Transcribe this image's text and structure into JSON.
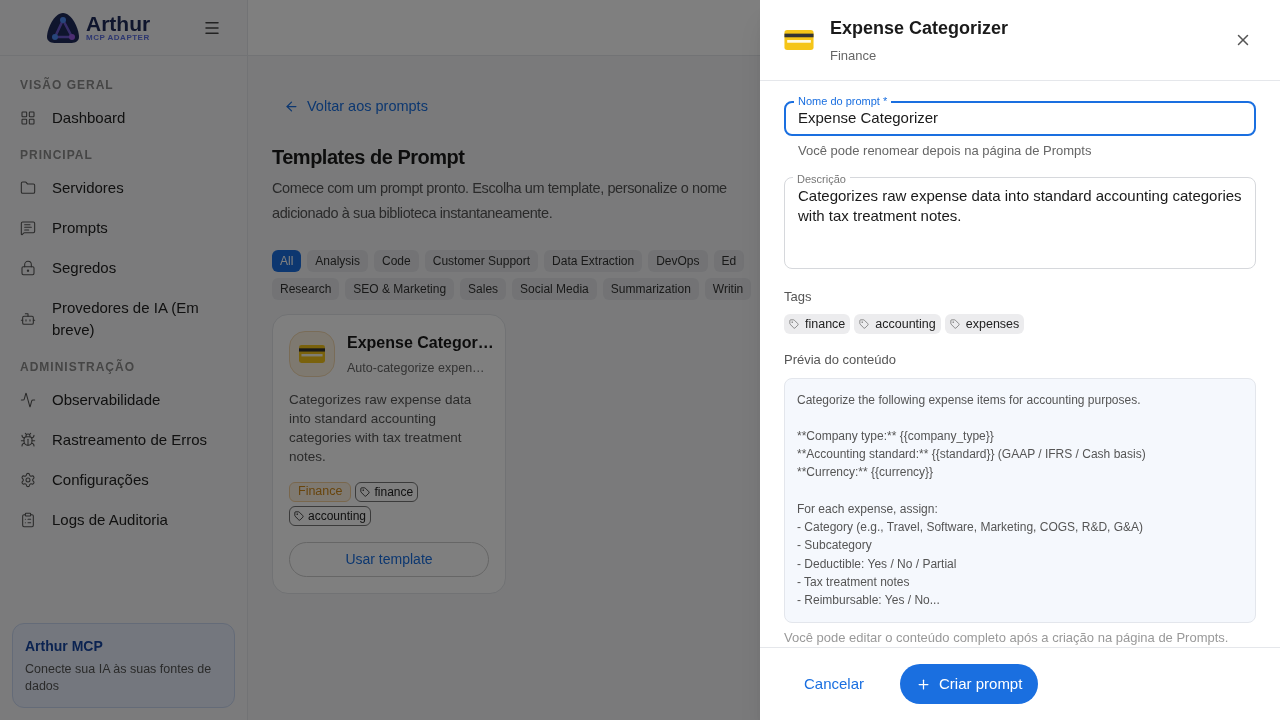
{
  "sidebar": {
    "logo": {
      "name": "Arthur",
      "tagline": "MCP ADAPTER"
    },
    "sections": [
      {
        "title": "VISÃO GERAL",
        "items": [
          {
            "label": "Dashboard"
          }
        ]
      },
      {
        "title": "PRINCIPAL",
        "items": [
          {
            "label": "Servidores"
          },
          {
            "label": "Prompts"
          },
          {
            "label": "Segredos"
          },
          {
            "label": "Provedores de IA (Em breve)"
          }
        ]
      },
      {
        "title": "ADMINISTRAÇÃO",
        "items": [
          {
            "label": "Observabilidade"
          },
          {
            "label": "Rastreamento de Erros"
          },
          {
            "label": "Configurações"
          },
          {
            "label": "Logs de Auditoria"
          }
        ]
      }
    ],
    "promo": {
      "title": "Arthur MCP",
      "text": "Conecte sua IA às suas fontes de dados"
    }
  },
  "main": {
    "back_link": "Voltar aos prompts",
    "title": "Templates de Prompt",
    "description_lines": [
      "Comece com um prompt pronto. Escolha um template, personalize o nome",
      "adicionado à sua biblioteca instantaneamente."
    ],
    "chip_rows": [
      [
        {
          "label": "All",
          "selected": true
        },
        {
          "label": "Analysis",
          "selected": false
        },
        {
          "label": "Code",
          "selected": false
        },
        {
          "label": "Customer Support",
          "selected": false
        },
        {
          "label": "Data Extraction",
          "selected": false
        },
        {
          "label": "DevOps",
          "selected": false
        },
        {
          "label": "Ed",
          "selected": false
        }
      ],
      [
        {
          "label": "Research",
          "selected": false
        },
        {
          "label": "SEO & Marketing",
          "selected": false
        },
        {
          "label": "Sales",
          "selected": false
        },
        {
          "label": "Social Media",
          "selected": false
        },
        {
          "label": "Summarization",
          "selected": false
        },
        {
          "label": "Writin",
          "selected": false
        }
      ]
    ],
    "cards": [
      {
        "title": "Expense Categor…",
        "subtitle": "Auto-categorize expen…",
        "description": "Categorizes raw expense data into standard accounting categories with tax treatment notes.",
        "category": "Finance",
        "tags": [
          "finance",
          "accounting"
        ],
        "button": "Usar template"
      }
    ]
  },
  "drawer": {
    "title": "Expense Categorizer",
    "category": "Finance",
    "name_field": {
      "label": "Nome do prompt *",
      "value": "Expense Categorizer",
      "helper": "Você pode renomear depois na página de Prompts"
    },
    "description_field": {
      "label": "Descrição",
      "value": "Categorizes raw expense data into standard accounting categories with tax treatment notes."
    },
    "tags_label": "Tags",
    "tags": [
      "finance",
      "accounting",
      "expenses"
    ],
    "preview_label": "Prévia do conteúdo",
    "preview_blocks": [
      [
        "Categorize the following expense items for accounting purposes."
      ],
      [
        "**Company type:** {{company_type}}",
        "**Accounting standard:** {{standard}} (GAAP / IFRS / Cash basis)",
        "**Currency:** {{currency}}"
      ],
      [
        "For each expense, assign:",
        "- Category (e.g., Travel, Software, Marketing, COGS, R&D, G&A)",
        "- Subcategory",
        "- Deductible: Yes / No / Partial",
        "- Tax treatment notes",
        "- Reimbursable: Yes / No..."
      ]
    ],
    "preview_note": "Você pode editar o conteúdo completo após a criação na página de Prompts.",
    "cancel": "Cancelar",
    "submit": "Criar prompt"
  }
}
